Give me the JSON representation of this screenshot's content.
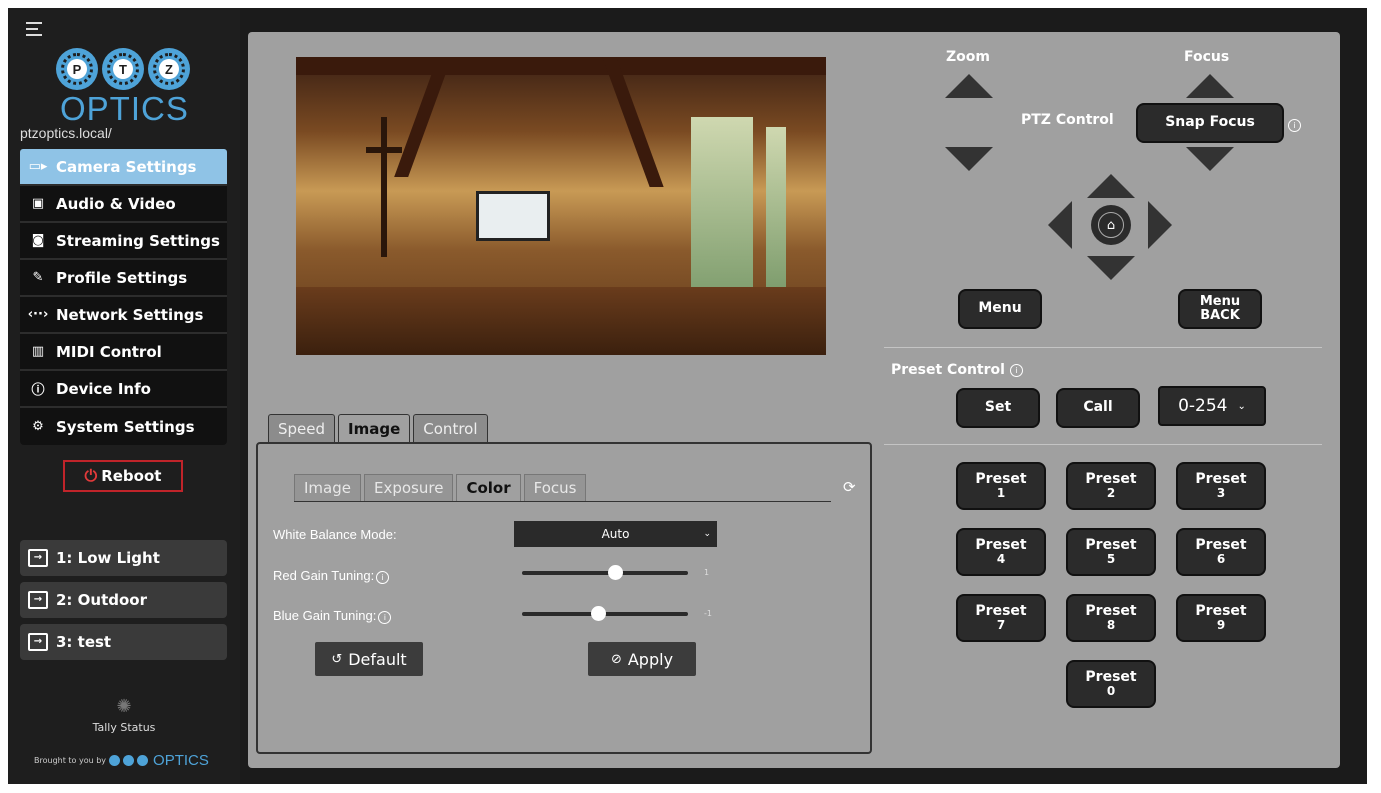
{
  "sidebar": {
    "logo_letters": [
      "P",
      "T",
      "Z"
    ],
    "logo_word": "OPTICS",
    "host": "ptzoptics.local/",
    "items": [
      {
        "label": "Camera Settings",
        "icon": "camera-icon"
      },
      {
        "label": "Audio & Video",
        "icon": "audio-video-icon"
      },
      {
        "label": "Streaming Settings",
        "icon": "streaming-icon"
      },
      {
        "label": "Profile Settings",
        "icon": "profile-icon"
      },
      {
        "label": "Network Settings",
        "icon": "network-icon"
      },
      {
        "label": "MIDI Control",
        "icon": "midi-icon"
      },
      {
        "label": "Device Info",
        "icon": "info-icon"
      },
      {
        "label": "System Settings",
        "icon": "gear-icon"
      }
    ],
    "reboot_label": "Reboot",
    "profiles": [
      "1: Low Light",
      "2: Outdoor",
      "3: test"
    ],
    "tally_label": "Tally Status",
    "brought_by": "Brought to you by",
    "brought_word": "OPTICS"
  },
  "tabs": [
    "Speed",
    "Image",
    "Control"
  ],
  "subtabs": [
    "Image",
    "Exposure",
    "Color",
    "Focus"
  ],
  "color_settings": {
    "white_balance_label": "White Balance Mode:",
    "white_balance_value": "Auto",
    "red_gain_label": "Red Gain Tuning:",
    "red_gain_value": "1",
    "red_gain_fraction": 0.56,
    "blue_gain_label": "Blue Gain Tuning:",
    "blue_gain_value": "-1",
    "blue_gain_fraction": 0.46,
    "default_label": "Default",
    "apply_label": "Apply"
  },
  "ptz": {
    "zoom_label": "Zoom",
    "focus_label": "Focus",
    "ptz_control_label": "PTZ Control",
    "snap_focus_label": "Snap Focus",
    "menu_label": "Menu",
    "menu_back_label": "Menu BACK"
  },
  "preset_control": {
    "label": "Preset Control",
    "set_label": "Set",
    "call_label": "Call",
    "range_value": "0-254",
    "presets": [
      {
        "label": "Preset",
        "num": "1"
      },
      {
        "label": "Preset",
        "num": "2"
      },
      {
        "label": "Preset",
        "num": "3"
      },
      {
        "label": "Preset",
        "num": "4"
      },
      {
        "label": "Preset",
        "num": "5"
      },
      {
        "label": "Preset",
        "num": "6"
      },
      {
        "label": "Preset",
        "num": "7"
      },
      {
        "label": "Preset",
        "num": "8"
      },
      {
        "label": "Preset",
        "num": "9"
      },
      {
        "label": "Preset",
        "num": "0"
      }
    ]
  },
  "colors": {
    "accent": "#4ea3d8",
    "active_nav": "#8fc3e6",
    "panel": "#a0a0a0",
    "reboot_border": "#c0242a"
  }
}
